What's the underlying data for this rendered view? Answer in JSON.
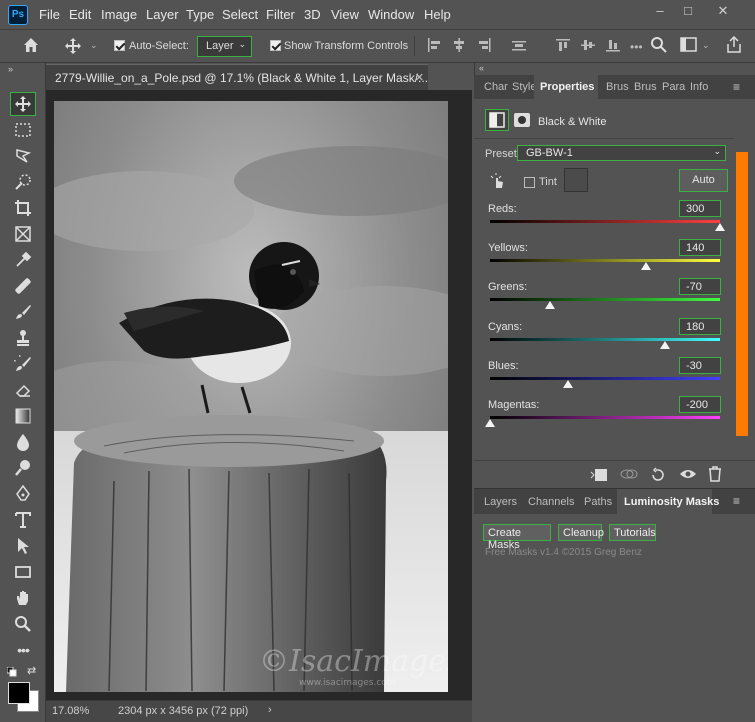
{
  "menu": {
    "logo": "Ps",
    "items": [
      "File",
      "Edit",
      "Image",
      "Layer",
      "Type",
      "Select",
      "Filter",
      "3D",
      "View",
      "Window",
      "Help"
    ]
  },
  "window_controls": {
    "minimize": "–",
    "maximize": "□",
    "close": "✕"
  },
  "options": {
    "auto_select_label": "Auto-Select:",
    "layer_select_value": "Layer",
    "transform_label": "Show Transform Controls"
  },
  "document": {
    "tab_title": "2779-Willie_on_a_Pole.psd @ 17.1% (Black & White 1, Layer Mask/...",
    "watermark": "©IsacImages",
    "watermark_url": "www.isacimages.com",
    "zoom": "17.08%",
    "dimensions": "2304 px x 3456 px (72 ppi)"
  },
  "panel_tabs": [
    "Char",
    "Style",
    "Properties",
    "Brus",
    "Brus",
    "Para",
    "Info"
  ],
  "properties": {
    "adjustment_title": "Black & White",
    "preset_label": "Preset:",
    "preset_value": "GB-BW-1",
    "tint_label": "Tint",
    "auto_label": "Auto",
    "sliders": [
      {
        "label": "Reds:",
        "value": "300",
        "pos": 1.0,
        "gradient": [
          "#000000",
          "#ff4040"
        ]
      },
      {
        "label": "Yellows:",
        "value": "140",
        "pos": 0.68,
        "gradient": [
          "#000000",
          "#ffff40"
        ]
      },
      {
        "label": "Greens:",
        "value": "-70",
        "pos": 0.26,
        "gradient": [
          "#000000",
          "#40ff40"
        ]
      },
      {
        "label": "Cyans:",
        "value": "180",
        "pos": 0.76,
        "gradient": [
          "#000000",
          "#40ffff"
        ]
      },
      {
        "label": "Blues:",
        "value": "-30",
        "pos": 0.34,
        "gradient": [
          "#000000",
          "#4040ff"
        ]
      },
      {
        "label": "Magentas:",
        "value": "-200",
        "pos": 0.0,
        "gradient": [
          "#000000",
          "#ff40ff"
        ]
      }
    ]
  },
  "lower_tabs": [
    "Layers",
    "Channels",
    "Paths",
    "Luminosity Masks"
  ],
  "luminosity": {
    "buttons": [
      "Create Masks",
      "Cleanup",
      "Tutorials"
    ],
    "footer": "Free Masks v1.4 ©2015 Greg Benz"
  },
  "accent": "#3cb043"
}
